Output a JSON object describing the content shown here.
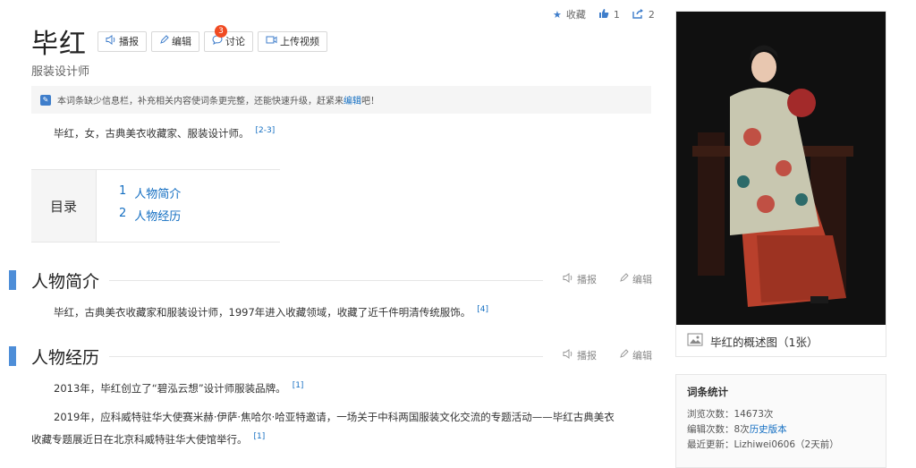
{
  "top_actions": {
    "collect": "收藏",
    "like_count": "1",
    "share_count": "2"
  },
  "title": "毕红",
  "tools": {
    "play": "播报",
    "edit": "编辑",
    "discuss": "讨论",
    "discuss_badge": "3",
    "upload": "上传视频"
  },
  "subtitle": "服装设计师",
  "notice": {
    "text_before": "本词条缺少信息栏，补充相关内容使词条更完整，还能快速升级，赶紧来",
    "link": "编辑",
    "text_after": "吧！"
  },
  "summary": {
    "text": "毕红，女，古典美衣收藏家、服装设计师。",
    "ref": "[2-3]"
  },
  "toc": {
    "head": "目录",
    "items": [
      {
        "num": "1",
        "label": "人物简介"
      },
      {
        "num": "2",
        "label": "人物经历"
      }
    ]
  },
  "sections": [
    {
      "title": "人物简介",
      "play": "播报",
      "edit": "编辑",
      "paras": [
        {
          "text": "毕红，古典美衣收藏家和服装设计师，1997年进入收藏领域，收藏了近千件明清传统服饰。",
          "ref": "[4]"
        }
      ]
    },
    {
      "title": "人物经历",
      "play": "播报",
      "edit": "编辑",
      "paras": [
        {
          "text": "2013年，毕红创立了“碧泓云想”设计师服装品牌。",
          "ref": "[1]"
        },
        {
          "line1": "2019年，应科威特驻华大使赛米赫·伊萨·焦哈尔·哈亚特邀请，一场关于中科两国服装文化交流的专题活动——毕红古典美衣",
          "line2": "收藏专题展近日在北京科威特驻华大使馆举行。",
          "ref": "[1]"
        }
      ]
    }
  ],
  "album": {
    "caption": "毕红的概述图（1张）"
  },
  "stats": {
    "head": "词条统计",
    "views_label": "浏览次数：",
    "views": "14673次",
    "edits_label": "编辑次数：",
    "edits": "8次",
    "history_link": "历史版本",
    "updated_label": "最近更新：",
    "updated_user": "Lizhiwei0606",
    "updated_time": "（2天前）"
  },
  "colors": {
    "link": "#136ec2",
    "accent_bar": "#4e8ed8",
    "badge": "#f04b23"
  }
}
